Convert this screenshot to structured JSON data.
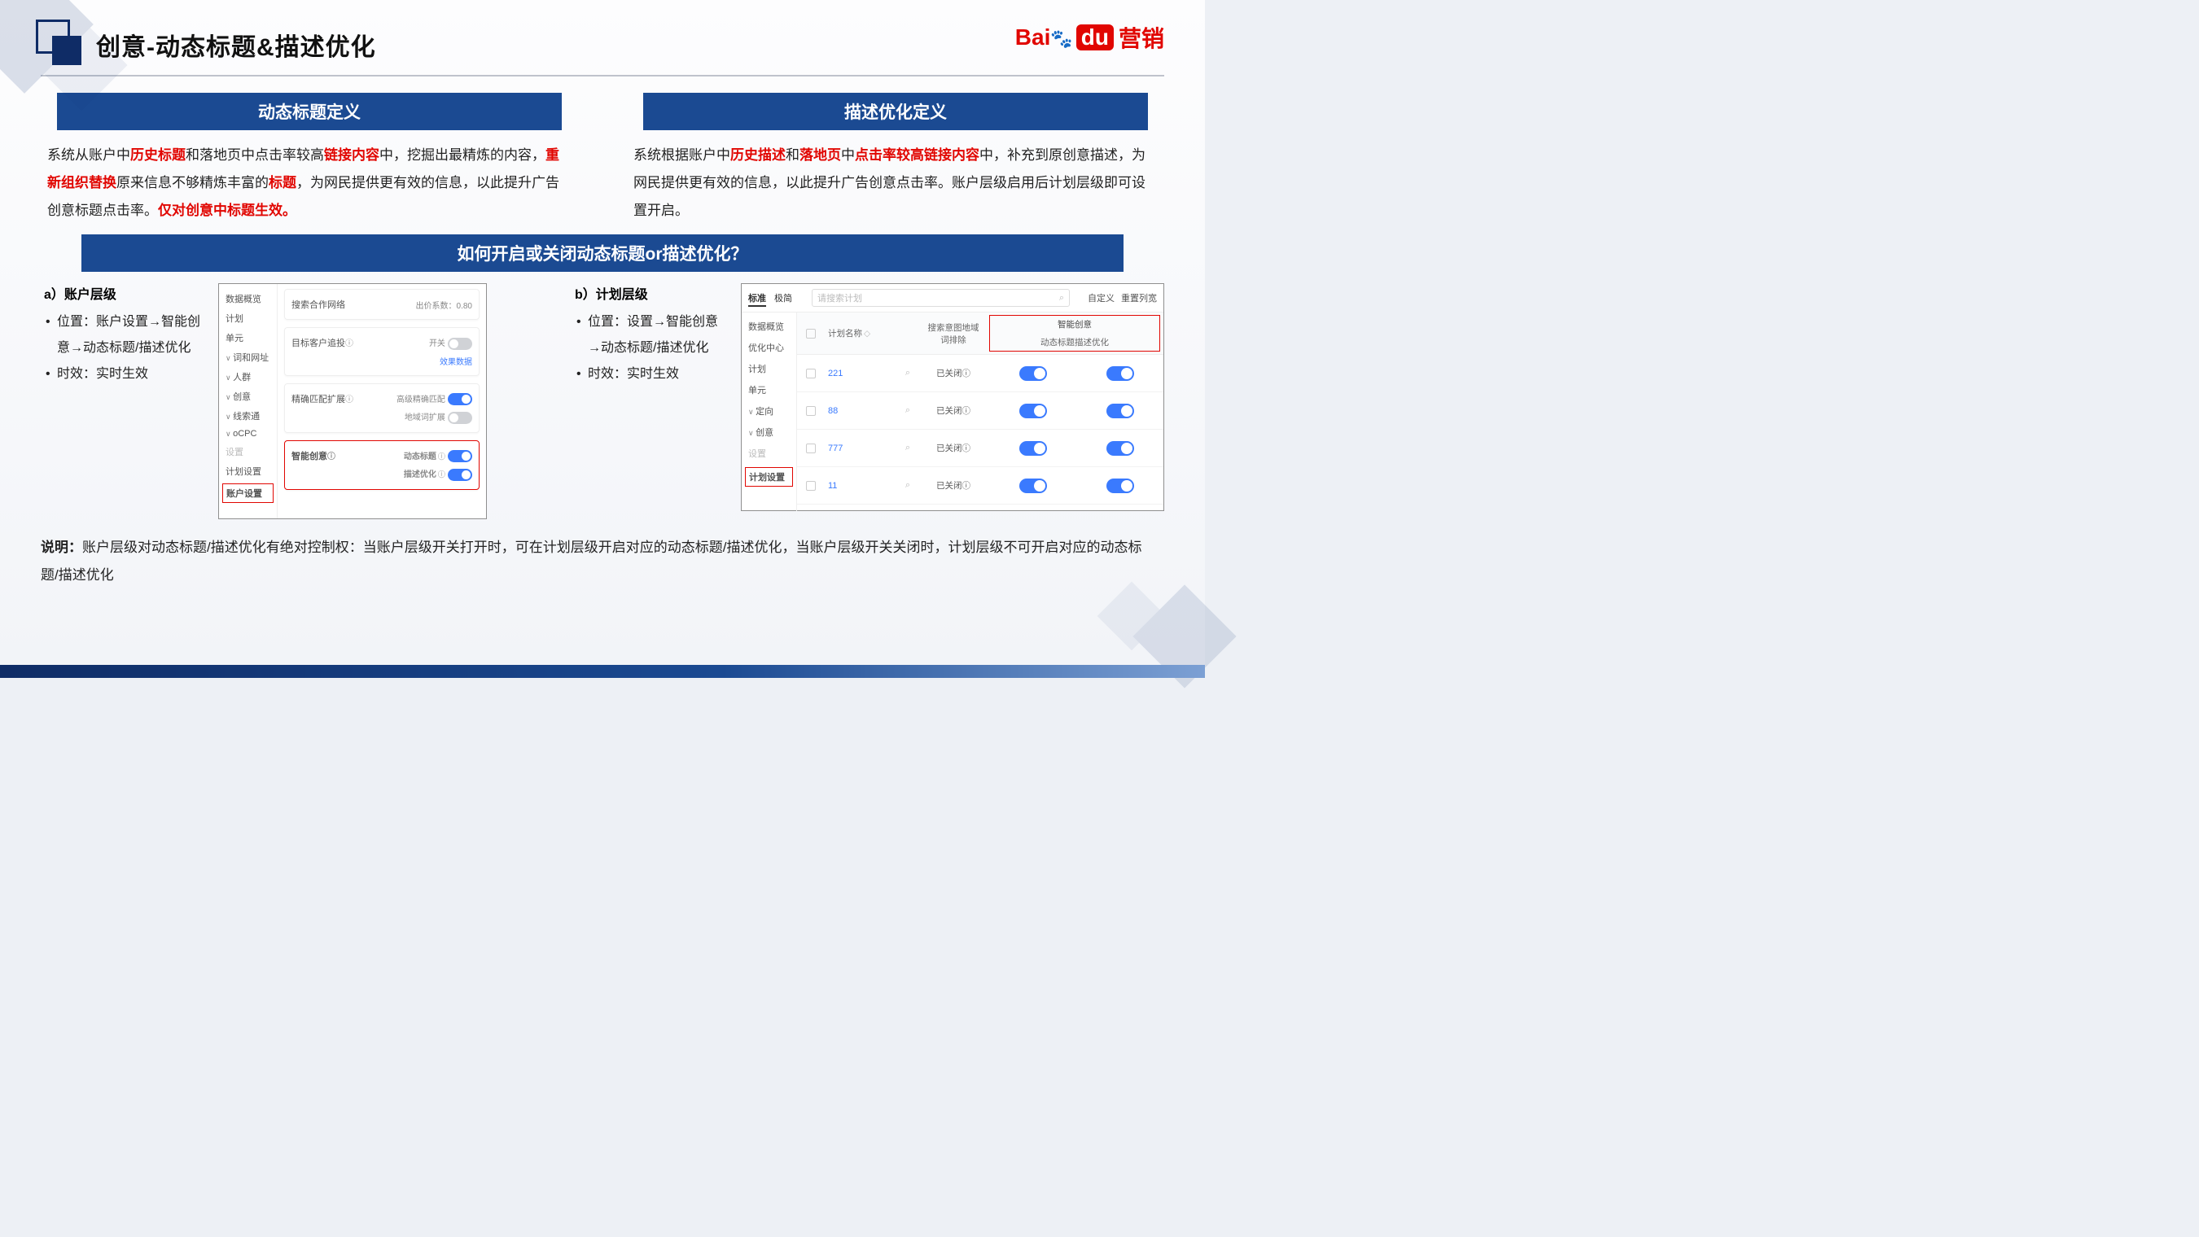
{
  "header": {
    "title": "创意-动态标题&描述优化",
    "logo_bai": "Bai",
    "logo_du": "du",
    "logo_paw": "🐾",
    "logo_yx": "营销"
  },
  "left": {
    "band": "动态标题定义",
    "d1a": "系统从账户中",
    "d1_hist": "历史标题",
    "d1b": "和落地页中点击率较高",
    "d1_link": "链接内容",
    "d1c": "中，挖掘出最精炼的内容，",
    "d1_reorg": "重新组织替换",
    "d1d": "原来信息不够精炼丰富的",
    "d1_title": "标题",
    "d1e": "，为网民提供更有效的信息，以此提升广告创意标题点击率。",
    "d1_only": "仅对创意中标题生效。"
  },
  "right": {
    "band": "描述优化定义",
    "d2a": "系统根据账户中",
    "d2_hist": "历史描述",
    "d2b": "和",
    "d2_land": "落地页",
    "d2c": "中",
    "d2_link": "点击率较高链接内容",
    "d2d": "中，补充到原创意描述，为网民提供更有效的信息，以此提升广告创意点击率。账户层级启用后计划层级即可设置开启。"
  },
  "band_full": "如何开启或关闭动态标题or描述优化？",
  "a": {
    "head": "a）账户层级",
    "b1": "位置：账户设置→智能创意→动态标题/描述优化",
    "b2": "时效：实时生效"
  },
  "b": {
    "head": "b）计划层级",
    "b1": "位置：设置→智能创意→动态标题/描述优化",
    "b2": "时效：实时生效"
  },
  "shotA": {
    "nav": {
      "n1": "数据概览",
      "n2": "计划",
      "n3": "单元",
      "n4": "词和网址",
      "n5": "人群",
      "n6": "创意",
      "n7": "线索通",
      "n8": "oCPC",
      "n9": "设置",
      "n10": "计划设置",
      "n11": "账户设置"
    },
    "c1": {
      "lbl": "搜索合作网络",
      "sub": "出价系数：",
      "val": "0.80"
    },
    "c2": {
      "lbl": "目标客户追投",
      "info": "ⓘ",
      "sw": "开关",
      "link": "效果数据"
    },
    "c3": {
      "lbl": "精确匹配扩展",
      "info": "ⓘ",
      "r1": "高级精确匹配",
      "r2": "地域词扩展"
    },
    "c4": {
      "lbl": "智能创意",
      "info": "ⓘ",
      "r1": "动态标题",
      "r2": "描述优化"
    }
  },
  "shotB": {
    "tab1": "标准",
    "tab2": "极简",
    "search_ph": "请搜索计划",
    "btn1": "自定义",
    "btn2": "重置列宽",
    "nav": {
      "n1": "数据概览",
      "n2": "优化中心",
      "n3": "计划",
      "n4": "单元",
      "n5": "定向",
      "n6": "创意",
      "n7": "设置",
      "n8": "计划设置"
    },
    "th": {
      "c2": "计划名称",
      "c4a": "搜索意图地域",
      "c4b": "词排除",
      "grp": "智能创意",
      "g1": "动态标题",
      "g2": "描述优化"
    },
    "rows": [
      {
        "name": "221",
        "stat": "已关闭"
      },
      {
        "name": "88",
        "stat": "已关闭"
      },
      {
        "name": "777",
        "stat": "已关闭"
      },
      {
        "name": "11",
        "stat": "已关闭"
      }
    ],
    "sort": "◇",
    "searchic": "⌕",
    "info": "ⓘ"
  },
  "note": {
    "lbl": "说明：",
    "txt": "账户层级对动态标题/描述优化有绝对控制权：当账户层级开关打开时，可在计划层级开启对应的动态标题/描述优化，当账户层级开关关闭时，计划层级不可开启对应的动态标题/描述优化"
  }
}
